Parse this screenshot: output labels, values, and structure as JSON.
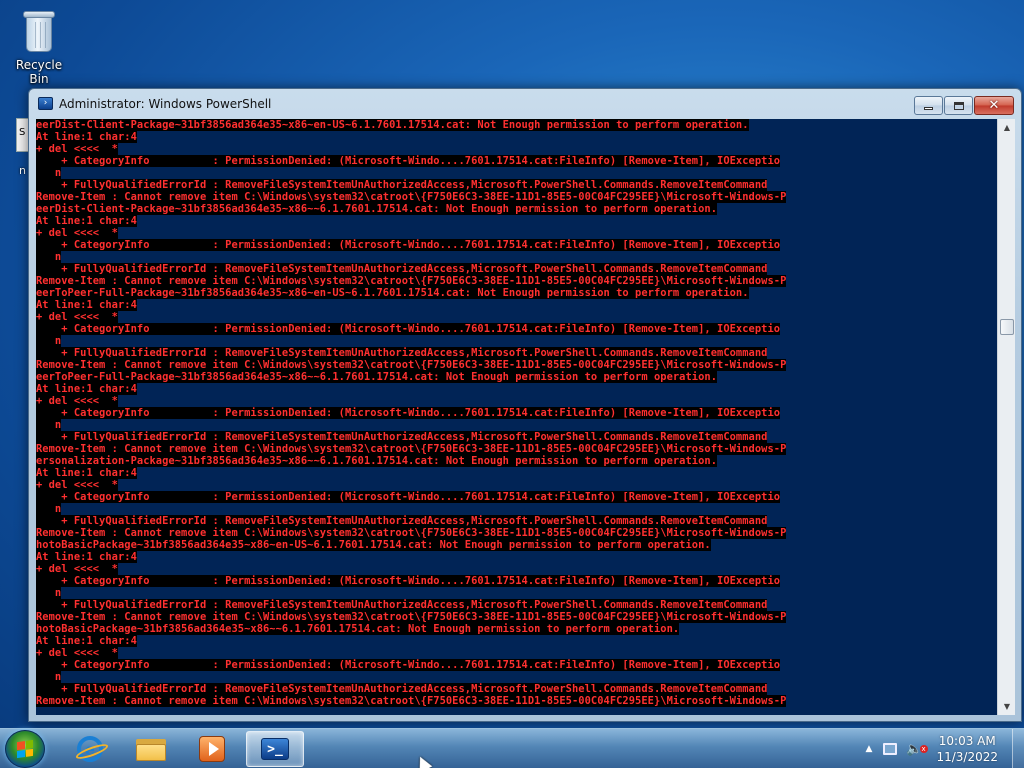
{
  "desktop": {
    "icons": [
      {
        "label": "Recycle Bin",
        "icon": "recycle-bin-icon"
      }
    ],
    "behind_window_text": "S",
    "behind_text": "n"
  },
  "window": {
    "title": "Administrator: Windows PowerShell",
    "icon": "powershell-icon",
    "buttons": {
      "minimize": "minimize",
      "maximize": "maximize",
      "close": "✕"
    },
    "console_colors": {
      "background": "#012456",
      "error_text": "#ff3030",
      "highlight": "#000000"
    },
    "console_lines": [
      "eerDist-Client-Package~31bf3856ad364e35~x86~en-US~6.1.7601.17514.cat: Not Enough permission to perform operation.",
      "At line:1 char:4",
      "+ del <<<<  *",
      "    + CategoryInfo          : PermissionDenied: (Microsoft-Windo....7601.17514.cat:FileInfo) [Remove-Item], IOExceptio",
      "   n",
      "    + FullyQualifiedErrorId : RemoveFileSystemItemUnAuthorizedAccess,Microsoft.PowerShell.Commands.RemoveItemCommand",
      "Remove-Item : Cannot remove item C:\\Windows\\system32\\catroot\\{F750E6C3-38EE-11D1-85E5-00C04FC295EE}\\Microsoft-Windows-P",
      "eerDist-Client-Package~31bf3856ad364e35~x86~~6.1.7601.17514.cat: Not Enough permission to perform operation.",
      "At line:1 char:4",
      "+ del <<<<  *",
      "    + CategoryInfo          : PermissionDenied: (Microsoft-Windo....7601.17514.cat:FileInfo) [Remove-Item], IOExceptio",
      "   n",
      "    + FullyQualifiedErrorId : RemoveFileSystemItemUnAuthorizedAccess,Microsoft.PowerShell.Commands.RemoveItemCommand",
      "Remove-Item : Cannot remove item C:\\Windows\\system32\\catroot\\{F750E6C3-38EE-11D1-85E5-00C04FC295EE}\\Microsoft-Windows-P",
      "eerToPeer-Full-Package~31bf3856ad364e35~x86~en-US~6.1.7601.17514.cat: Not Enough permission to perform operation.",
      "At line:1 char:4",
      "+ del <<<<  *",
      "    + CategoryInfo          : PermissionDenied: (Microsoft-Windo....7601.17514.cat:FileInfo) [Remove-Item], IOExceptio",
      "   n",
      "    + FullyQualifiedErrorId : RemoveFileSystemItemUnAuthorizedAccess,Microsoft.PowerShell.Commands.RemoveItemCommand",
      "Remove-Item : Cannot remove item C:\\Windows\\system32\\catroot\\{F750E6C3-38EE-11D1-85E5-00C04FC295EE}\\Microsoft-Windows-P",
      "eerToPeer-Full-Package~31bf3856ad364e35~x86~~6.1.7601.17514.cat: Not Enough permission to perform operation.",
      "At line:1 char:4",
      "+ del <<<<  *",
      "    + CategoryInfo          : PermissionDenied: (Microsoft-Windo....7601.17514.cat:FileInfo) [Remove-Item], IOExceptio",
      "   n",
      "    + FullyQualifiedErrorId : RemoveFileSystemItemUnAuthorizedAccess,Microsoft.PowerShell.Commands.RemoveItemCommand",
      "Remove-Item : Cannot remove item C:\\Windows\\system32\\catroot\\{F750E6C3-38EE-11D1-85E5-00C04FC295EE}\\Microsoft-Windows-P",
      "ersonalization-Package~31bf3856ad364e35~x86~~6.1.7601.17514.cat: Not Enough permission to perform operation.",
      "At line:1 char:4",
      "+ del <<<<  *",
      "    + CategoryInfo          : PermissionDenied: (Microsoft-Windo....7601.17514.cat:FileInfo) [Remove-Item], IOExceptio",
      "   n",
      "    + FullyQualifiedErrorId : RemoveFileSystemItemUnAuthorizedAccess,Microsoft.PowerShell.Commands.RemoveItemCommand",
      "Remove-Item : Cannot remove item C:\\Windows\\system32\\catroot\\{F750E6C3-38EE-11D1-85E5-00C04FC295EE}\\Microsoft-Windows-P",
      "hotoBasicPackage~31bf3856ad364e35~x86~en-US~6.1.7601.17514.cat: Not Enough permission to perform operation.",
      "At line:1 char:4",
      "+ del <<<<  *",
      "    + CategoryInfo          : PermissionDenied: (Microsoft-Windo....7601.17514.cat:FileInfo) [Remove-Item], IOExceptio",
      "   n",
      "    + FullyQualifiedErrorId : RemoveFileSystemItemUnAuthorizedAccess,Microsoft.PowerShell.Commands.RemoveItemCommand",
      "Remove-Item : Cannot remove item C:\\Windows\\system32\\catroot\\{F750E6C3-38EE-11D1-85E5-00C04FC295EE}\\Microsoft-Windows-P",
      "hotoBasicPackage~31bf3856ad364e35~x86~~6.1.7601.17514.cat: Not Enough permission to perform operation.",
      "At line:1 char:4",
      "+ del <<<<  *",
      "    + CategoryInfo          : PermissionDenied: (Microsoft-Windo....7601.17514.cat:FileInfo) [Remove-Item], IOExceptio",
      "   n",
      "    + FullyQualifiedErrorId : RemoveFileSystemItemUnAuthorizedAccess,Microsoft.PowerShell.Commands.RemoveItemCommand",
      "Remove-Item : Cannot remove item C:\\Windows\\system32\\catroot\\{F750E6C3-38EE-11D1-85E5-00C04FC295EE}\\Microsoft-Windows-P"
    ],
    "scrollbar": {
      "up_arrow": "▲",
      "down_arrow": "▼"
    }
  },
  "taskbar": {
    "start_icon": "windows-start-orb-icon",
    "pinned": [
      {
        "name": "internet-explorer",
        "icon": "internet-explorer-icon",
        "glyph": "e"
      },
      {
        "name": "windows-explorer",
        "icon": "folder-icon"
      },
      {
        "name": "media-player",
        "icon": "media-player-icon"
      },
      {
        "name": "powershell",
        "icon": "powershell-icon",
        "glyph": ">_",
        "active": true
      }
    ],
    "tray": {
      "chevron": "▲",
      "volume_glyph": "🔈",
      "volume_muted_mark": "x",
      "time": "10:03 AM",
      "date": "11/3/2022"
    }
  }
}
